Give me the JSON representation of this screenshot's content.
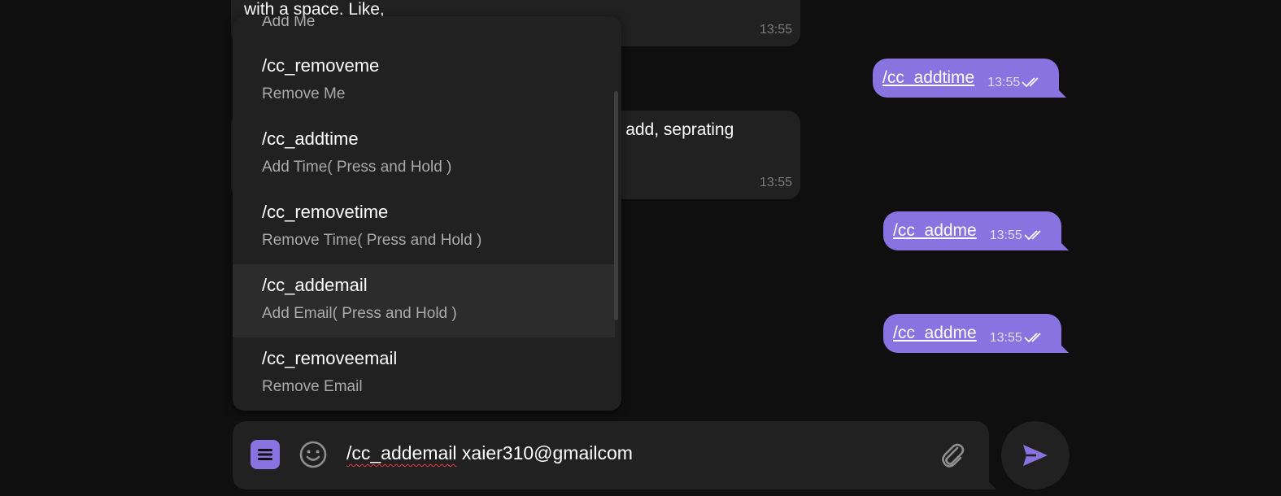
{
  "chat": {
    "incoming": [
      {
        "text": "with a space. Like,",
        "time": "13:55"
      },
      {
        "text": "na add, seprating",
        "time": "13:55"
      }
    ],
    "outgoing": [
      {
        "command": "/cc_addtime",
        "time": "13:55",
        "status_icon": "double-check-icon"
      },
      {
        "command": "/cc_addme",
        "time": "13:55",
        "status_icon": "double-check-icon"
      },
      {
        "command": "/cc_addme",
        "time": "13:55",
        "status_icon": "double-check-icon"
      }
    ]
  },
  "command_menu": {
    "partial_top_description": "Add Me",
    "items": [
      {
        "command": "/cc_removeme",
        "description": "Remove Me"
      },
      {
        "command": "/cc_addtime",
        "description": "Add Time( Press and Hold )"
      },
      {
        "command": "/cc_removetime",
        "description": "Remove Time( Press and Hold )"
      },
      {
        "command": "/cc_addemail",
        "description": "Add Email( Press and Hold )",
        "highlighted": true
      },
      {
        "command": "/cc_removeemail",
        "description": "Remove Email"
      }
    ]
  },
  "composer": {
    "input_command": "/cc_addemail",
    "input_argument": " xaier310@gmailcom",
    "icons": {
      "menu": "menu-icon",
      "emoji": "emoji-icon",
      "attach": "paperclip-icon",
      "send": "send-icon"
    }
  },
  "colors": {
    "background": "#0f0f0f",
    "bubble_incoming": "#212121",
    "bubble_outgoing": "#8774e1",
    "accent": "#8774e1",
    "menu_background": "#212121",
    "menu_highlight": "#2c2c2c"
  }
}
